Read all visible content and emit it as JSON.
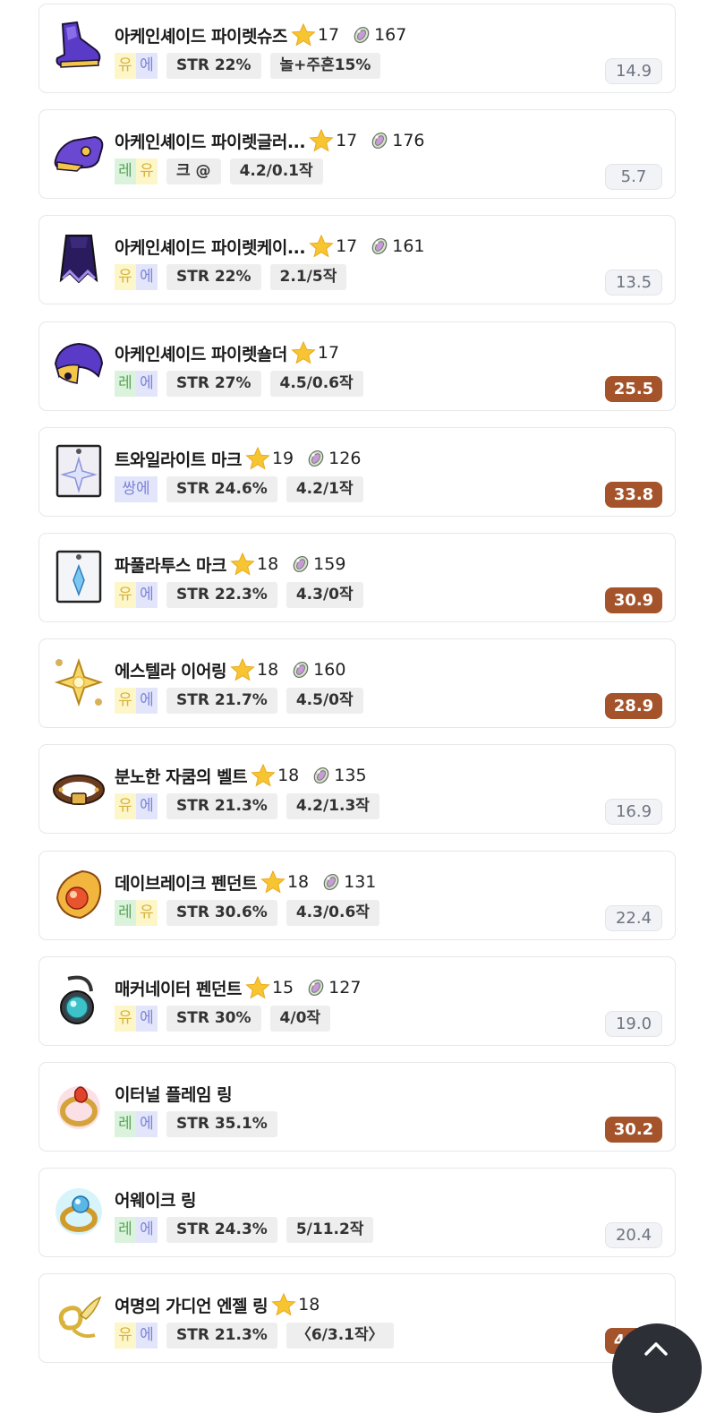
{
  "items": [
    {
      "name": "아케인셰이드 파이렛슈즈",
      "star": "17",
      "gem": "167",
      "pot": [
        [
          "유",
          "yu"
        ],
        [
          "에",
          "e"
        ]
      ],
      "stat": "STR 22%",
      "extra": "놀+주흔15%",
      "score": "14.9",
      "hi": false,
      "icon": "shoes-icon"
    },
    {
      "name": "아케인셰이드 파이렛글러...",
      "star": "17",
      "gem": "176",
      "pot": [
        [
          "레",
          "re"
        ],
        [
          "유",
          "yu"
        ]
      ],
      "stat": "크 @",
      "extra": "4.2/0.1작",
      "score": "5.7",
      "hi": false,
      "icon": "gloves-icon"
    },
    {
      "name": "아케인셰이드 파이렛케이...",
      "star": "17",
      "gem": "161",
      "pot": [
        [
          "유",
          "yu"
        ],
        [
          "에",
          "e"
        ]
      ],
      "stat": "STR 22%",
      "extra": "2.1/5작",
      "score": "13.5",
      "hi": false,
      "icon": "cape-icon"
    },
    {
      "name": "아케인셰이드 파이렛숄더",
      "star": "17",
      "gem": "",
      "pot": [
        [
          "레",
          "re"
        ],
        [
          "에",
          "e"
        ]
      ],
      "stat": "STR 27%",
      "extra": "4.5/0.6작",
      "score": "25.5",
      "hi": true,
      "icon": "shoulder-icon"
    },
    {
      "name": "트와일라이트 마크",
      "star": "19",
      "gem": "126",
      "pot": [
        [
          "쌍에",
          "ssang"
        ]
      ],
      "stat": "STR 24.6%",
      "extra": "4.2/1작",
      "score": "33.8",
      "hi": true,
      "icon": "twilight-mark-icon"
    },
    {
      "name": "파풀라투스 마크",
      "star": "18",
      "gem": "159",
      "pot": [
        [
          "유",
          "yu"
        ],
        [
          "에",
          "e"
        ]
      ],
      "stat": "STR 22.3%",
      "extra": "4.3/0작",
      "score": "30.9",
      "hi": true,
      "icon": "papulatus-mark-icon"
    },
    {
      "name": "에스텔라 이어링",
      "star": "18",
      "gem": "160",
      "pot": [
        [
          "유",
          "yu"
        ],
        [
          "에",
          "e"
        ]
      ],
      "stat": "STR 21.7%",
      "extra": "4.5/0작",
      "score": "28.9",
      "hi": true,
      "icon": "earring-icon"
    },
    {
      "name": "분노한 자쿰의 벨트",
      "star": "18",
      "gem": "135",
      "pot": [
        [
          "유",
          "yu"
        ],
        [
          "에",
          "e"
        ]
      ],
      "stat": "STR 21.3%",
      "extra": "4.2/1.3작",
      "score": "16.9",
      "hi": false,
      "icon": "belt-icon"
    },
    {
      "name": "데이브레이크 펜던트",
      "star": "18",
      "gem": "131",
      "pot": [
        [
          "레",
          "re"
        ],
        [
          "유",
          "yu"
        ]
      ],
      "stat": "STR 30.6%",
      "extra": "4.3/0.6작",
      "score": "22.4",
      "hi": false,
      "icon": "daybreak-pendant-icon"
    },
    {
      "name": "매커네이터 펜던트",
      "star": "15",
      "gem": "127",
      "pot": [
        [
          "유",
          "yu"
        ],
        [
          "에",
          "e"
        ]
      ],
      "stat": "STR 30%",
      "extra": "4/0작",
      "score": "19.0",
      "hi": false,
      "icon": "mechanator-pendant-icon"
    },
    {
      "name": "이터널 플레임 링",
      "star": "",
      "gem": "",
      "pot": [
        [
          "레",
          "re"
        ],
        [
          "에",
          "e"
        ]
      ],
      "stat": "STR 35.1%",
      "extra": "",
      "score": "30.2",
      "hi": true,
      "icon": "flame-ring-icon"
    },
    {
      "name": "어웨이크 링",
      "star": "",
      "gem": "",
      "pot": [
        [
          "레",
          "re"
        ],
        [
          "에",
          "e"
        ]
      ],
      "stat": "STR 24.3%",
      "extra": "5/11.2작",
      "score": "20.4",
      "hi": false,
      "icon": "awake-ring-icon"
    },
    {
      "name": "여명의 가디언 엔젤 링",
      "star": "18",
      "gem": "",
      "pot": [
        [
          "유",
          "yu"
        ],
        [
          "에",
          "e"
        ]
      ],
      "stat": "STR 21.3%",
      "extra": "〈6/3.1작〉",
      "score": "48.2",
      "hi": true,
      "icon": "angel-ring-icon"
    }
  ],
  "colors": {
    "score_high": "#a4532a",
    "score_low": "#f2f3f6",
    "star": "#f7c531"
  },
  "fab": {
    "icon": "chevron-up-icon"
  }
}
